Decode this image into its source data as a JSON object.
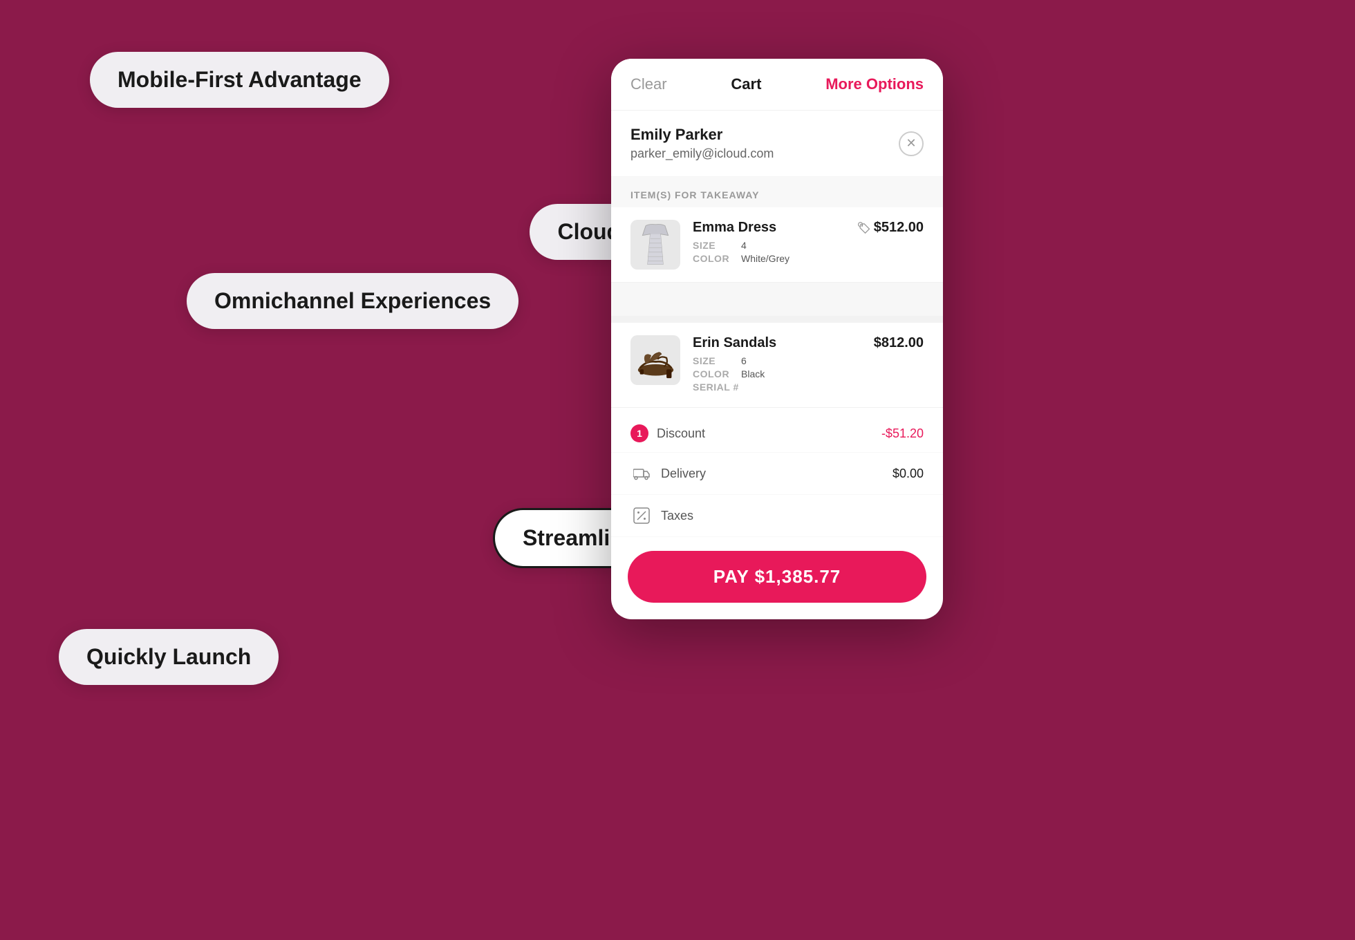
{
  "background_color": "#8B1A4A",
  "pills": {
    "mobile_first": "Mobile-First Advantage",
    "cloud_based": "Cloud-Based Architecture",
    "omnichannel": "Omnichannel Experiences",
    "quickly_launch": "Quickly Launch",
    "streamline": "Streamline Order Processing"
  },
  "app": {
    "header": {
      "clear": "Clear",
      "cart": "Cart",
      "more_options": "More Options"
    },
    "customer": {
      "name": "Emily Parker",
      "email": "parker_emily@icloud.com"
    },
    "items_label": "ITEM(S) FOR TAKEAWAY",
    "items": [
      {
        "name": "Emma Dress",
        "price": "$512.00",
        "attributes": [
          {
            "key": "SIZE",
            "value": "4"
          },
          {
            "key": "COLOR",
            "value": "White/Grey"
          }
        ],
        "type": "dress"
      },
      {
        "name": "Erin Sandals",
        "price": "$812.00",
        "attributes": [
          {
            "key": "SIZE",
            "value": "6"
          },
          {
            "key": "COLOR",
            "value": "Black"
          },
          {
            "key": "SERIAL #",
            "value": ""
          }
        ],
        "type": "sandals"
      }
    ],
    "summary": [
      {
        "label": "Discount",
        "value": "-$51.20",
        "type": "discount",
        "icon": "badge"
      },
      {
        "label": "Delivery",
        "value": "$0.00",
        "type": "normal",
        "icon": "truck"
      },
      {
        "label": "Taxes",
        "value": "",
        "type": "normal",
        "icon": "percent"
      }
    ],
    "pay_button": "PAY $1,385.77"
  }
}
